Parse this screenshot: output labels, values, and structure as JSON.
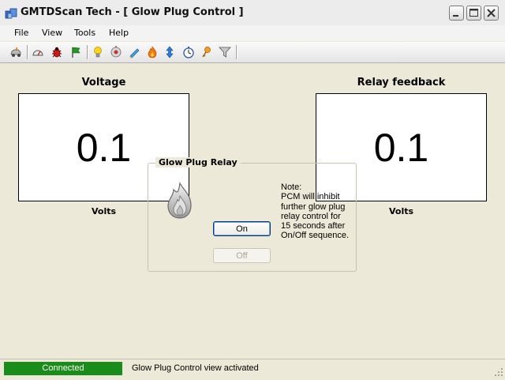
{
  "window": {
    "title": "GMTDScan Tech - [ Glow Plug Control ]"
  },
  "menu": {
    "items": [
      "File",
      "View",
      "Tools",
      "Help"
    ]
  },
  "toolbar": {
    "icons": [
      "car-connect-icon",
      "gauge-icon",
      "bug-icon",
      "flag-icon",
      "lightbulb-icon",
      "injector-icon",
      "pencil-icon",
      "flame-icon",
      "up-down-arrows-icon",
      "stopwatch-icon",
      "key-icon",
      "filter-icon"
    ]
  },
  "voltage": {
    "title": "Voltage",
    "value": "0.1",
    "unit": "Volts"
  },
  "relay_feedback": {
    "title": "Relay feedback",
    "value": "0.1",
    "unit": "Volts"
  },
  "glow_plug_relay": {
    "title": "Glow Plug Relay",
    "note": "Note:\nPCM will inhibit\nfurther glow plug\nrelay control for\n15 seconds after\nOn/Off sequence.",
    "on_label": "On",
    "off_label": "Off"
  },
  "status": {
    "connection": "Connected",
    "connection_color": "#1a8c1a",
    "message": "Glow Plug Control view activated"
  }
}
